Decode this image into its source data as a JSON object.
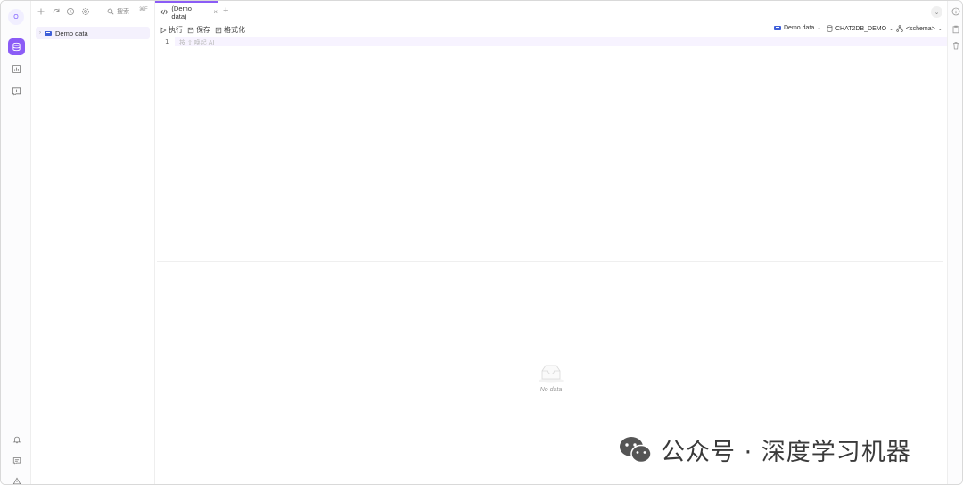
{
  "rail": {
    "avatar_letter": "O",
    "accent": "#8b5cf6"
  },
  "tree": {
    "search_label": "搜索",
    "search_shortcut": "⌘F",
    "items": [
      {
        "label": "Demo data",
        "expanded": false
      }
    ]
  },
  "tabs": [
    {
      "label": "(Demo data)",
      "active": true
    }
  ],
  "actions": {
    "run": "执行",
    "save": "保存",
    "format": "格式化"
  },
  "selectors": {
    "datasource": "Demo data",
    "database": "CHAT2DB_DEMO",
    "schema": "<schema>"
  },
  "editor": {
    "line_number": "1",
    "placeholder": "按  ⇧  唤起 AI"
  },
  "results": {
    "empty_text": "No data"
  },
  "watermark": {
    "text": "公众号 · 深度学习机器"
  }
}
